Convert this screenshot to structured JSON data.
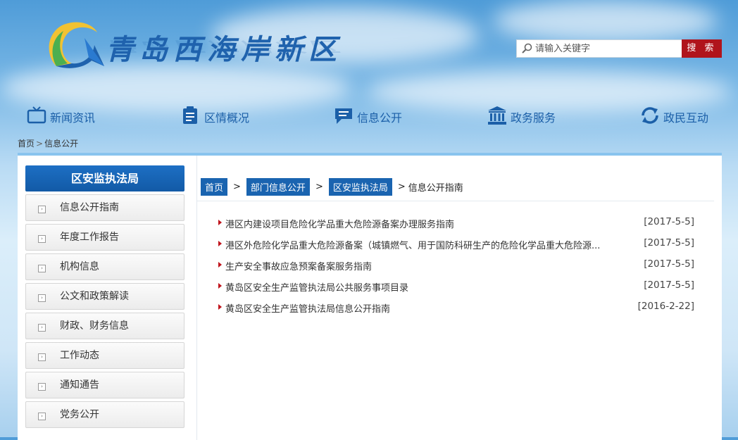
{
  "header": {
    "site_title": "青岛西海岸新区",
    "search_placeholder": "请输入关键字",
    "search_button": "搜 索"
  },
  "nav": {
    "items": [
      {
        "label": "新闻资讯",
        "icon": "tv-icon"
      },
      {
        "label": "区情概况",
        "icon": "clipboard-icon"
      },
      {
        "label": "信息公开",
        "icon": "chat-icon"
      },
      {
        "label": "政务服务",
        "icon": "building-icon"
      },
      {
        "label": "政民互动",
        "icon": "refresh-icon"
      }
    ]
  },
  "top_breadcrumb": {
    "home": "首页",
    "separator": ">",
    "current": "信息公开"
  },
  "sidebar": {
    "title": "区安监执法局",
    "items": [
      {
        "label": "信息公开指南"
      },
      {
        "label": "年度工作报告"
      },
      {
        "label": "机构信息"
      },
      {
        "label": "公文和政策解读"
      },
      {
        "label": "财政、财务信息"
      },
      {
        "label": "工作动态"
      },
      {
        "label": "通知通告"
      },
      {
        "label": "党务公开"
      }
    ]
  },
  "content_breadcrumb": {
    "items": [
      "首页",
      "部门信息公开",
      "区安监执法局"
    ],
    "separator": ">",
    "current": "信息公开指南"
  },
  "articles": [
    {
      "title": "港区内建设项目危险化学品重大危险源备案办理服务指南",
      "date": "[2017-5-5]"
    },
    {
      "title": "港区外危险化学品重大危险源备案（城镇燃气、用于国防科研生产的危险化学品重大危险源...",
      "date": "[2017-5-5]"
    },
    {
      "title": "生产安全事故应急预案备案服务指南",
      "date": "[2017-5-5]"
    },
    {
      "title": "黄岛区安全生产监管执法局公共服务事项目录",
      "date": "[2017-5-5]"
    },
    {
      "title": "黄岛区安全生产监管执法局信息公开指南",
      "date": "[2016-2-22]"
    }
  ],
  "colors": {
    "brand_blue": "#1b5fa8",
    "search_red": "#b0141c",
    "arrow_red": "#c0141c"
  }
}
